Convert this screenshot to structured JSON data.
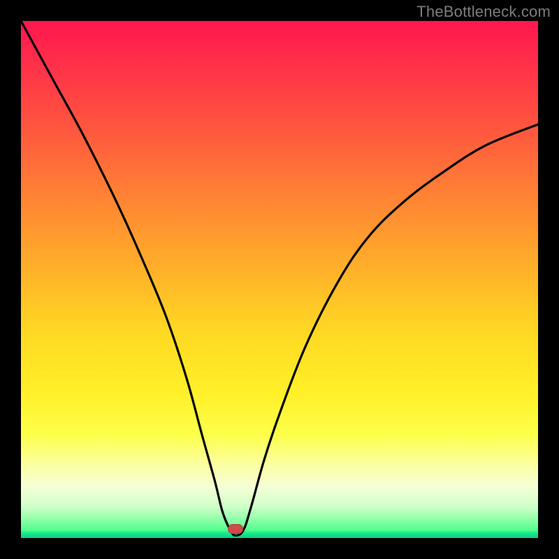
{
  "watermark": {
    "text": "TheBottleneck.com"
  },
  "marker": {
    "x_pct": 41.5,
    "y_pct": 98.3
  },
  "chart_data": {
    "type": "line",
    "title": "",
    "xlabel": "",
    "ylabel": "",
    "xlim": [
      0,
      100
    ],
    "ylim": [
      0,
      100
    ],
    "note": "V-shaped bottleneck curve on a heatmap-style gradient background. x is an implicit normalized axis (0–100). y ≈ bottleneck percentage (0 = green/good, 100 = red/bad). The minimum sits near x≈42 where y≈0; the curve rises steeply toward both edges. Values are read off pixel positions relative to the plot area.",
    "series": [
      {
        "name": "bottleneck_pct",
        "x": [
          0,
          6,
          12,
          18,
          23,
          28,
          32,
          35,
          37.5,
          39,
          40.5,
          41.5,
          43,
          44.5,
          47,
          50,
          55,
          61,
          67,
          74,
          82,
          90,
          100
        ],
        "y": [
          100,
          89,
          78,
          66,
          55,
          43,
          31,
          20,
          11,
          5,
          1.5,
          0.5,
          1.5,
          6,
          15,
          24,
          37,
          49,
          58,
          65,
          71,
          76,
          80
        ]
      }
    ],
    "marker_point": {
      "x": 41.5,
      "y": 0.5
    }
  }
}
